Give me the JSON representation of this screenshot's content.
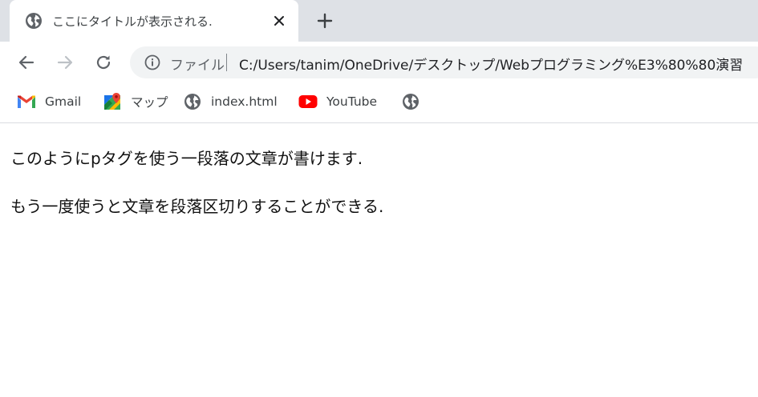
{
  "tab": {
    "title": "ここにタイトルが表示される.",
    "icon": "globe-icon"
  },
  "toolbar": {
    "back_icon": "back-arrow-icon",
    "forward_icon": "forward-arrow-icon",
    "reload_icon": "reload-icon",
    "omnibox": {
      "info_icon": "info-icon",
      "scheme_label": "ファイル",
      "url": "C:/Users/tanim/OneDrive/デスクトップ/Webプログラミング%E3%80%80演習"
    }
  },
  "bookmarks": [
    {
      "label": "Gmail",
      "icon": "gmail-icon"
    },
    {
      "label": "マップ",
      "icon": "maps-icon"
    },
    {
      "label": "index.html",
      "icon": "globe-icon"
    },
    {
      "label": "YouTube",
      "icon": "youtube-icon"
    },
    {
      "label": "",
      "icon": "globe-icon"
    }
  ],
  "page": {
    "paragraphs": [
      "このようにpタグを使う一段落の文章が書けます.",
      "もう一度使うと文章を段落区切りすることができる."
    ]
  },
  "colors": {
    "tabstrip_bg": "#dee1e6",
    "omnibox_bg": "#f1f3f4",
    "icon_gray": "#5f6368",
    "youtube_red": "#ff0000",
    "gmail_red": "#ea4335"
  }
}
